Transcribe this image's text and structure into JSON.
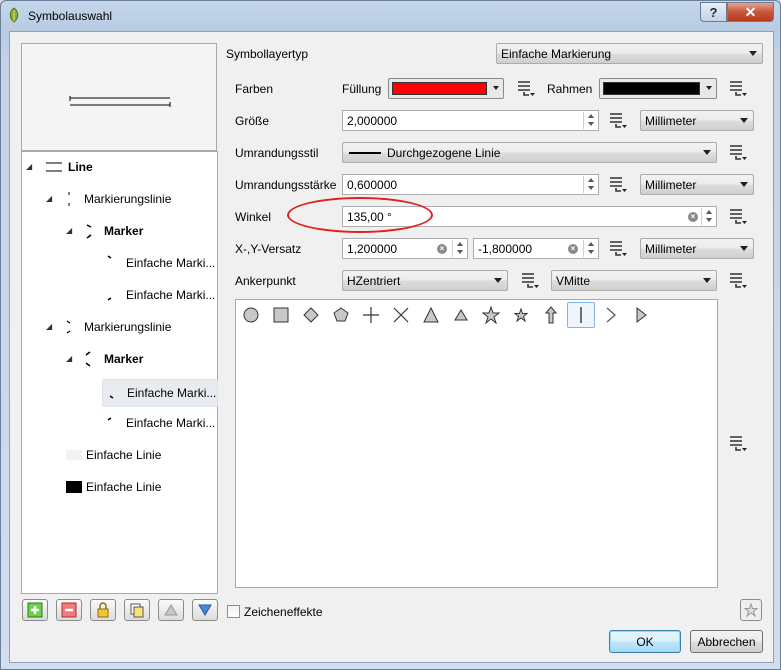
{
  "window": {
    "title": "Symbolauswahl",
    "help_glyph": "?",
    "close_glyph": "✕"
  },
  "tree": {
    "items": [
      {
        "label": "Line",
        "level": 0,
        "bold": true
      },
      {
        "label": "Markierungslinie",
        "level": 1,
        "bold": false
      },
      {
        "label": "Marker",
        "level": 2,
        "bold": true
      },
      {
        "label": "Einfache Marki...",
        "level": 3,
        "bold": false
      },
      {
        "label": "Einfache Marki...",
        "level": 3,
        "bold": false
      },
      {
        "label": "Markierungslinie",
        "level": 1,
        "bold": false
      },
      {
        "label": "Marker",
        "level": 2,
        "bold": true
      },
      {
        "label": "Einfache Marki...",
        "level": 3,
        "bold": false,
        "selected": true
      },
      {
        "label": "Einfache Marki...",
        "level": 3,
        "bold": false
      },
      {
        "label": "Einfache Linie",
        "level": 1,
        "bold": false
      },
      {
        "label": "Einfache Linie",
        "level": 1,
        "bold": false
      }
    ]
  },
  "form": {
    "symbollayertyp_label": "Symbollayertyp",
    "symbollayertyp_value": "Einfache Markierung",
    "farben_label": "Farben",
    "fuellung_label": "Füllung",
    "fuellung_color": "#ff0000",
    "rahmen_label": "Rahmen",
    "rahmen_color": "#000000",
    "groesse_label": "Größe",
    "groesse_value": "2,000000",
    "groesse_unit": "Millimeter",
    "umrandungsstil_label": "Umrandungsstil",
    "umrandungsstil_value": "Durchgezogene Linie",
    "umrandungsstaerke_label": "Umrandungsstärke",
    "umrandungsstaerke_value": "0,600000",
    "umrandungsstaerke_unit": "Millimeter",
    "winkel_label": "Winkel",
    "winkel_value": "135,00 °",
    "versatz_label": "X-,Y-Versatz",
    "versatz_x": "1,200000",
    "versatz_y": "-1,800000",
    "versatz_unit": "Millimeter",
    "ankerpunkt_label": "Ankerpunkt",
    "anker_h": "HZentriert",
    "anker_v": "VMitte"
  },
  "markers": [
    "circle",
    "square",
    "diamond",
    "pentagon",
    "cross",
    "x",
    "triangle",
    "equilateral-triangle",
    "star",
    "regular-star",
    "arrow",
    "line",
    "arrowhead",
    "filled-arrowhead"
  ],
  "selected_marker_index": 11,
  "bottom": {
    "zeicheneffekte_label": "Zeicheneffekte",
    "ok_label": "OK",
    "cancel_label": "Abbrechen"
  }
}
